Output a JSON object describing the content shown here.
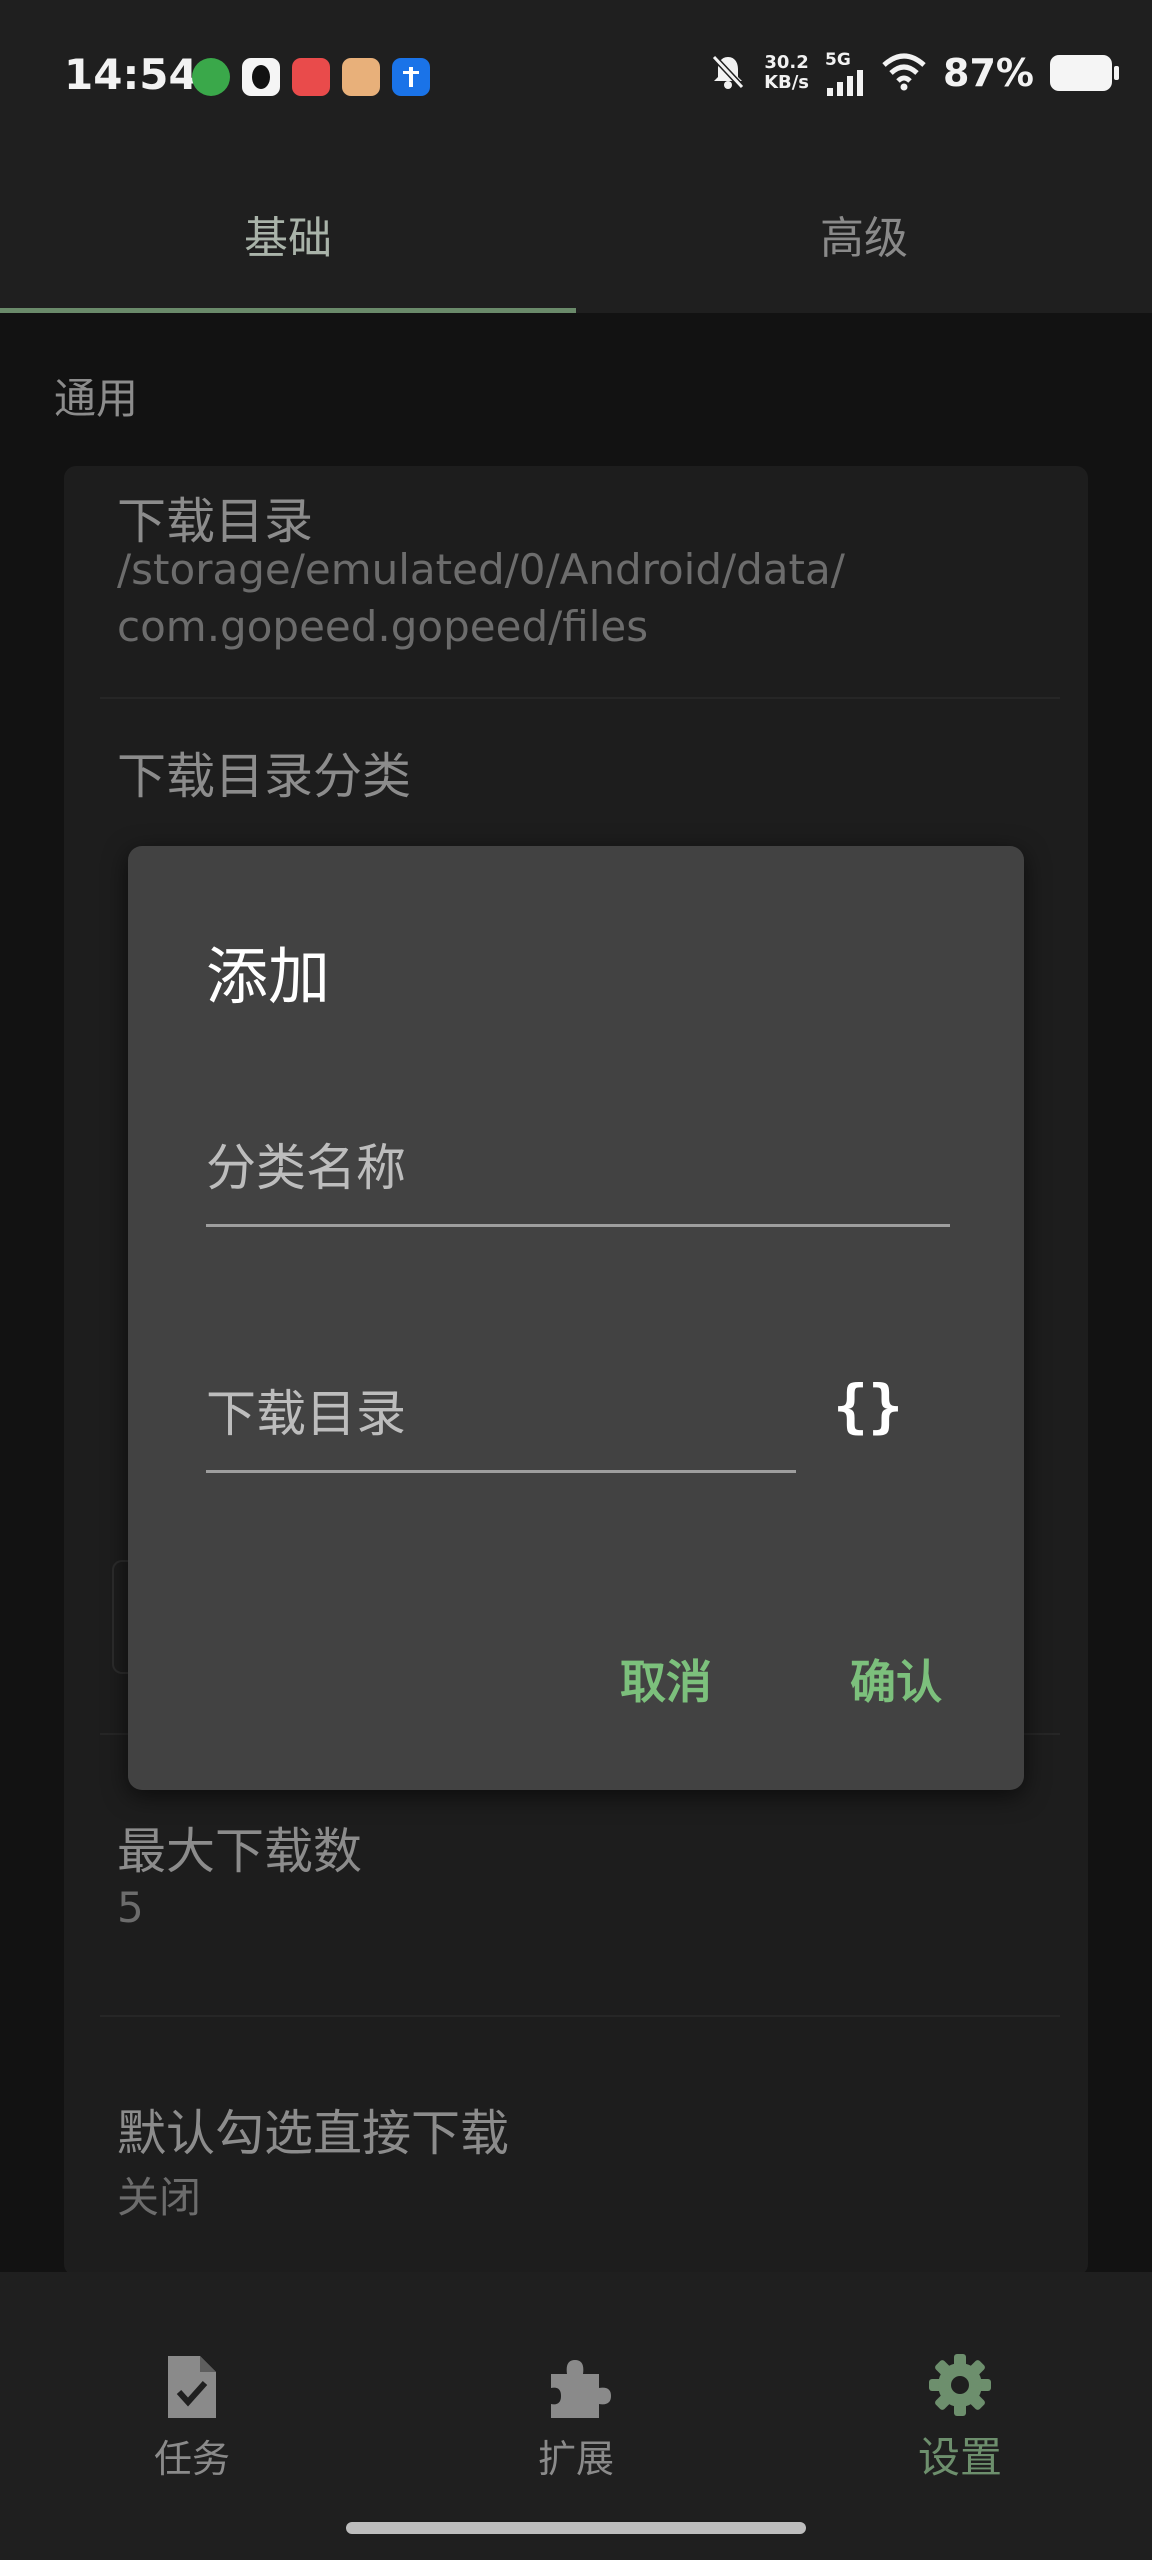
{
  "status_bar": {
    "time": "14:54",
    "speed_value": "30.2",
    "speed_unit": "KB/s",
    "network": "5G",
    "battery": "87%"
  },
  "tabs": [
    {
      "label": "基础"
    },
    {
      "label": "高级"
    }
  ],
  "settings": {
    "section": "通用",
    "download_dir": {
      "title": "下载目录",
      "value_line1": "/storage/emulated/0/Android/data/",
      "value_line2": "com.gopeed.gopeed/files"
    },
    "category_title": "下载目录分类",
    "max_downloads": {
      "title": "最大下载数",
      "value": "5"
    },
    "auto_download": {
      "title": "默认勾选直接下载",
      "value": "关闭"
    }
  },
  "dialog": {
    "title": "添加",
    "category_name_label": "分类名称",
    "download_dir_label": "下载目录",
    "cancel": "取消",
    "confirm": "确认"
  },
  "bottom_nav": [
    {
      "label": "任务"
    },
    {
      "label": "扩展"
    },
    {
      "label": "设置"
    }
  ],
  "colors": {
    "accent": "#7cc07c",
    "dialog_bg": "#424242",
    "active_nav": "#6d8f6d"
  }
}
